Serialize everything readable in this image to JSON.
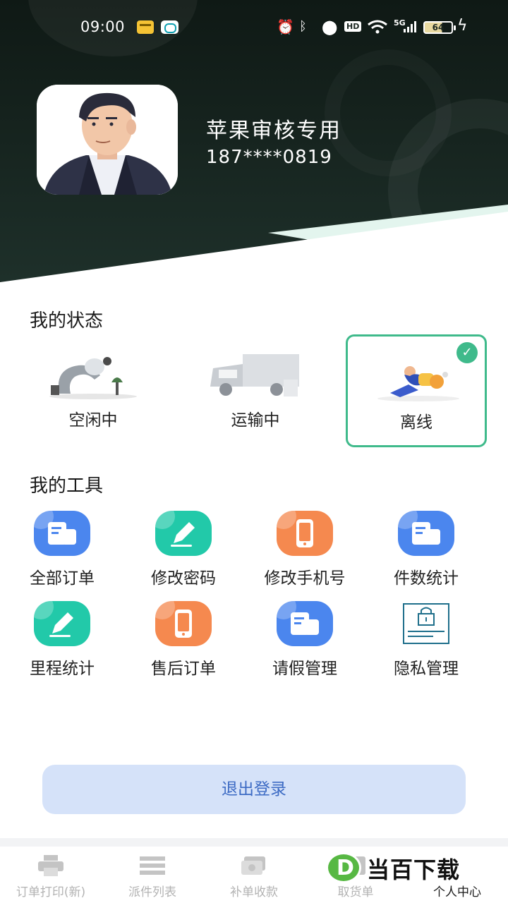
{
  "status_bar": {
    "time": "09:00",
    "network_badge": "HD",
    "network_type": "5G",
    "battery": "64"
  },
  "profile": {
    "name": "苹果审核专用",
    "phone": "187****0819"
  },
  "my_status": {
    "title": "我的状态",
    "options": [
      {
        "label": "空闲中",
        "selected": false
      },
      {
        "label": "运输中",
        "selected": false
      },
      {
        "label": "离线",
        "selected": true
      }
    ]
  },
  "my_tools": {
    "title": "我的工具",
    "items": [
      {
        "label": "全部订单",
        "icon": "document-icon",
        "color": "#4b86ee"
      },
      {
        "label": "修改密码",
        "icon": "pencil-icon",
        "color": "#22c9a9"
      },
      {
        "label": "修改手机号",
        "icon": "phone-icon",
        "color": "#f5894f"
      },
      {
        "label": "件数统计",
        "icon": "document-icon",
        "color": "#4b86ee"
      },
      {
        "label": "里程统计",
        "icon": "pencil-icon",
        "color": "#22c9a9"
      },
      {
        "label": "售后订单",
        "icon": "phone-icon",
        "color": "#f5894f"
      },
      {
        "label": "请假管理",
        "icon": "document-icon",
        "color": "#4b86ee"
      },
      {
        "label": "隐私管理",
        "icon": "lock-document-icon",
        "color": "#1f6f8b"
      }
    ]
  },
  "logout_label": "退出登录",
  "bottom_nav": {
    "items": [
      {
        "label": "订单打印(新)",
        "icon": "printer-icon",
        "active": false
      },
      {
        "label": "派件列表",
        "icon": "list-icon",
        "active": false
      },
      {
        "label": "补单收款",
        "icon": "payment-icon",
        "active": false
      },
      {
        "label": "取货单",
        "icon": "pickup-icon",
        "active": false
      },
      {
        "label": "个人中心",
        "icon": "person-icon",
        "active": true
      }
    ]
  },
  "watermark": {
    "letter": "D",
    "text": "当百下载"
  },
  "colors": {
    "accent_green": "#3fba8b",
    "header_dark": "#15221d",
    "logout_bg": "#d5e2f9",
    "logout_text": "#3d6bc4"
  }
}
